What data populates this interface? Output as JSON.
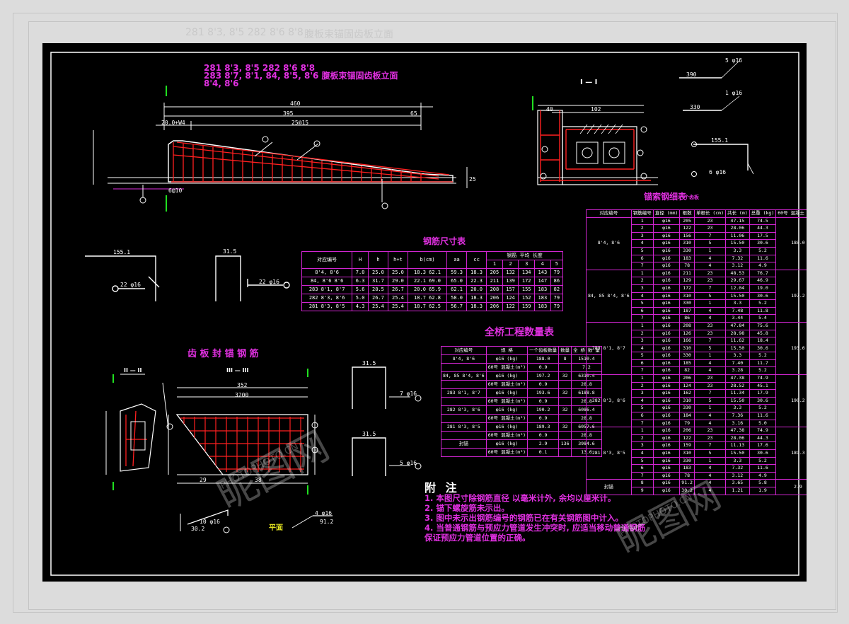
{
  "titles": {
    "elevation": "281 8'3, 8'5 282 8'6 8'8\n283 8'7, 8'1, 84, 8'5, 8'6 腹板束锚固齿板立面\n8'4, 8'6",
    "section": "I — I",
    "rebar_dim": "钢筋尺寸表",
    "detail": "齿 板 封 锚 钢 筋",
    "sec_a": "II — II",
    "sec_b": "III — III",
    "quantity": "全桥工程数量表",
    "detail_table": "锚索钢细表",
    "detail_table_sub": "一个齿板",
    "plan": "平面"
  },
  "rebar_dim_table": {
    "header": [
      "对应编号",
      "H",
      "h",
      "h+t",
      "b(cm)",
      "aa",
      "cc",
      "1",
      "2",
      "3",
      "4",
      "5"
    ],
    "group_header": "钢筋 平均 长度",
    "rows": [
      [
        "8'4, 8'6",
        "7.0",
        "25.0",
        "25.0",
        "18.3 62.1",
        "59.3",
        "18.3",
        "205",
        "132",
        "134",
        "143",
        "79"
      ],
      [
        "84, 8'6 8'6",
        "6.3",
        "31.7",
        "29.0",
        "22.1 69.0",
        "65.0",
        "22.3",
        "211",
        "139",
        "172",
        "147",
        "86"
      ],
      [
        "283 8'1, 8'7",
        "5.6",
        "28.5",
        "26.7",
        "20.0 65.9",
        "62.1",
        "20.0",
        "208",
        "157",
        "155",
        "183",
        "82"
      ],
      [
        "282 8'3, 8'6",
        "5.0",
        "26.7",
        "25.4",
        "18.7 62.8",
        "58.0",
        "18.3",
        "206",
        "124",
        "152",
        "183",
        "79"
      ],
      [
        "281 8'3, 8'5",
        "4.3",
        "25.4",
        "25.4",
        "18.7 62.5",
        "56.7",
        "18.3",
        "206",
        "122",
        "159",
        "183",
        "79"
      ]
    ]
  },
  "quantity_table": {
    "header": [
      "对应编号",
      "规 格",
      "一个齿板数量",
      "数量",
      "全 桥 数 量"
    ],
    "rows": [
      [
        "8'4, 8'6",
        "φ16 (kg)",
        "188.0",
        "8",
        "1510.4"
      ],
      [
        "",
        "60号 混凝土(m³)",
        "0.9",
        "",
        "7.2"
      ],
      [
        "84, 85 8'4, 8'6",
        "φ16 (kg)",
        "197.2",
        "32",
        "6310.4"
      ],
      [
        "",
        "60号 混凝土(m³)",
        "0.9",
        "",
        "28.8"
      ],
      [
        "283 8'1, 8'7",
        "φ16 (kg)",
        "193.6",
        "32",
        "6188.8"
      ],
      [
        "",
        "60号 混凝土(m³)",
        "0.9",
        "",
        "28.8"
      ],
      [
        "282 8'3, 8'6",
        "φ16 (kg)",
        "190.2",
        "32",
        "6086.4"
      ],
      [
        "",
        "60号 混凝土(m³)",
        "0.9",
        "",
        "28.8"
      ],
      [
        "281 8'3, 8'5",
        "φ16 (kg)",
        "189.3",
        "32",
        "6057.6"
      ],
      [
        "",
        "60号 混凝土(m³)",
        "0.9",
        "",
        "28.8"
      ],
      [
        "封锚",
        "φ16 (kg)",
        "2.9",
        "136",
        "3984.6"
      ],
      [
        "",
        "60号 混凝土(m³)",
        "0.1",
        "",
        "13.6"
      ]
    ]
  },
  "detail_table": {
    "header": [
      "对应编号",
      "钢筋编号",
      "直径 (mm)",
      "根数",
      "单根长 (cm)",
      "共长 (m)",
      "总重 (kg)",
      "60号 混凝土 (m³)"
    ],
    "groups": [
      {
        "name": "8'4, 8'6",
        "total": "188.0",
        "conc": "0.9",
        "rows": [
          [
            "1",
            "φ16",
            "205",
            "23",
            "47.15",
            "74.5"
          ],
          [
            "2",
            "φ16",
            "122",
            "23",
            "28.06",
            "44.3"
          ],
          [
            "3",
            "φ16",
            "156",
            "7",
            "11.06",
            "17.5"
          ],
          [
            "4",
            "φ16",
            "310",
            "5",
            "15.50",
            "30.6"
          ],
          [
            "5",
            "φ16",
            "330",
            "1",
            "3.3",
            "5.2"
          ],
          [
            "6",
            "φ16",
            "183",
            "4",
            "7.32",
            "11.6"
          ],
          [
            "7",
            "φ16",
            "78",
            "4",
            "3.12",
            "4.9"
          ]
        ]
      },
      {
        "name": "84, 85 8'4, 8'6",
        "total": "197.2",
        "conc": "0.9",
        "rows": [
          [
            "1",
            "φ16",
            "211",
            "23",
            "48.53",
            "76.7"
          ],
          [
            "2",
            "φ16",
            "129",
            "23",
            "29.67",
            "46.9"
          ],
          [
            "3",
            "φ16",
            "172",
            "7",
            "12.04",
            "19.0"
          ],
          [
            "4",
            "φ16",
            "310",
            "5",
            "15.50",
            "30.6"
          ],
          [
            "5",
            "φ16",
            "330",
            "1",
            "3.3",
            "5.2"
          ],
          [
            "6",
            "φ16",
            "187",
            "4",
            "7.48",
            "11.8"
          ],
          [
            "7",
            "φ16",
            "86",
            "4",
            "3.44",
            "5.4"
          ]
        ]
      },
      {
        "name": "283 8'1, 8'7",
        "total": "193.6",
        "conc": "0.9",
        "rows": [
          [
            "1",
            "φ16",
            "208",
            "23",
            "47.84",
            "75.6"
          ],
          [
            "2",
            "φ16",
            "126",
            "23",
            "28.98",
            "45.8"
          ],
          [
            "3",
            "φ16",
            "166",
            "7",
            "11.62",
            "18.4"
          ],
          [
            "4",
            "φ16",
            "310",
            "5",
            "15.50",
            "30.6"
          ],
          [
            "5",
            "φ16",
            "330",
            "1",
            "3.3",
            "5.2"
          ],
          [
            "6",
            "φ16",
            "185",
            "4",
            "7.40",
            "11.7"
          ],
          [
            "7",
            "φ16",
            "82",
            "4",
            "3.28",
            "5.2"
          ]
        ]
      },
      {
        "name": "282 8'3, 8'6",
        "total": "190.2",
        "conc": "0.9",
        "rows": [
          [
            "1",
            "φ16",
            "206",
            "23",
            "47.38",
            "74.9"
          ],
          [
            "2",
            "φ16",
            "124",
            "23",
            "28.52",
            "45.1"
          ],
          [
            "3",
            "φ16",
            "162",
            "7",
            "11.34",
            "17.9"
          ],
          [
            "4",
            "φ16",
            "310",
            "5",
            "15.50",
            "30.6"
          ],
          [
            "5",
            "φ16",
            "330",
            "1",
            "3.3",
            "5.2"
          ],
          [
            "6",
            "φ16",
            "184",
            "4",
            "7.36",
            "11.6"
          ],
          [
            "7",
            "φ16",
            "79",
            "4",
            "3.16",
            "5.0"
          ]
        ]
      },
      {
        "name": "281 8'3, 8'5",
        "total": "189.3",
        "conc": "0.9",
        "rows": [
          [
            "1",
            "φ16",
            "206",
            "23",
            "47.38",
            "74.9"
          ],
          [
            "2",
            "φ16",
            "122",
            "23",
            "28.06",
            "44.3"
          ],
          [
            "3",
            "φ16",
            "159",
            "7",
            "11.13",
            "17.6"
          ],
          [
            "4",
            "φ16",
            "310",
            "5",
            "15.50",
            "30.6"
          ],
          [
            "5",
            "φ16",
            "330",
            "1",
            "3.3",
            "5.2"
          ],
          [
            "6",
            "φ16",
            "183",
            "4",
            "7.32",
            "11.6"
          ],
          [
            "7",
            "φ16",
            "78",
            "4",
            "3.12",
            "4.9"
          ]
        ]
      },
      {
        "name": "封锚",
        "total": "2.9",
        "conc": "0.1",
        "rows": [
          [
            "8",
            "φ16",
            "91.2",
            "4",
            "3.65",
            "5.8"
          ],
          [
            "9",
            "φ16",
            "30.2",
            "4",
            "1.21",
            "1.9"
          ]
        ]
      }
    ]
  },
  "notes": {
    "head": "附 注",
    "lines": [
      "1. 本图尺寸除钢筋直径    以毫米计外, 余均以厘米计。",
      "2. 锚下螺旋筋未示出。",
      "3. 图中未示出钢筋编号的钢筋已在有关钢筋图中计入。",
      "4. 当普通钢筋与预应力管道发生冲突时, 应适当移动普通钢筋",
      "   保证预应力管道位置的正确。"
    ]
  },
  "dims": {
    "total_len": "460",
    "len_395": "395",
    "len_65": "65",
    "seg_a": "20.0+W4",
    "seg_b": "25@15",
    "bottom": "6@10",
    "v_25": "25",
    "sec_40": "40",
    "sec_102": "102",
    "det_352": "352",
    "det_3200": "3200",
    "det_38": "38",
    "det_29": "29",
    "shape_31_5": "31.5",
    "shape_155_1": "155.1",
    "shape_390": "390",
    "shape_330": "330",
    "lbl_22": "22 φ16",
    "lbl_7": "7 φ16",
    "lbl_5": "5 φ16",
    "lbl_1": "1 φ16",
    "lbl_6": "6 φ16",
    "lbl_4": "4 φ16",
    "lbl_10": "10 φ16",
    "dim_30_2": "30.2",
    "dim_91_2": "91.2"
  },
  "watermark": {
    "main": "昵图网",
    "sub": "PHOTOPHOTO.CN"
  },
  "ghost_texts": [
    "281 8'3, 8'5 282 8'6 8'8",
    "腹板束锚固齿板立面"
  ],
  "colors": {
    "magenta": "#e030e0",
    "red": "#ff2020",
    "green": "#20e020",
    "white": "#ffffff",
    "yellow": "#e0e020",
    "cyan": "#20e0e0"
  }
}
